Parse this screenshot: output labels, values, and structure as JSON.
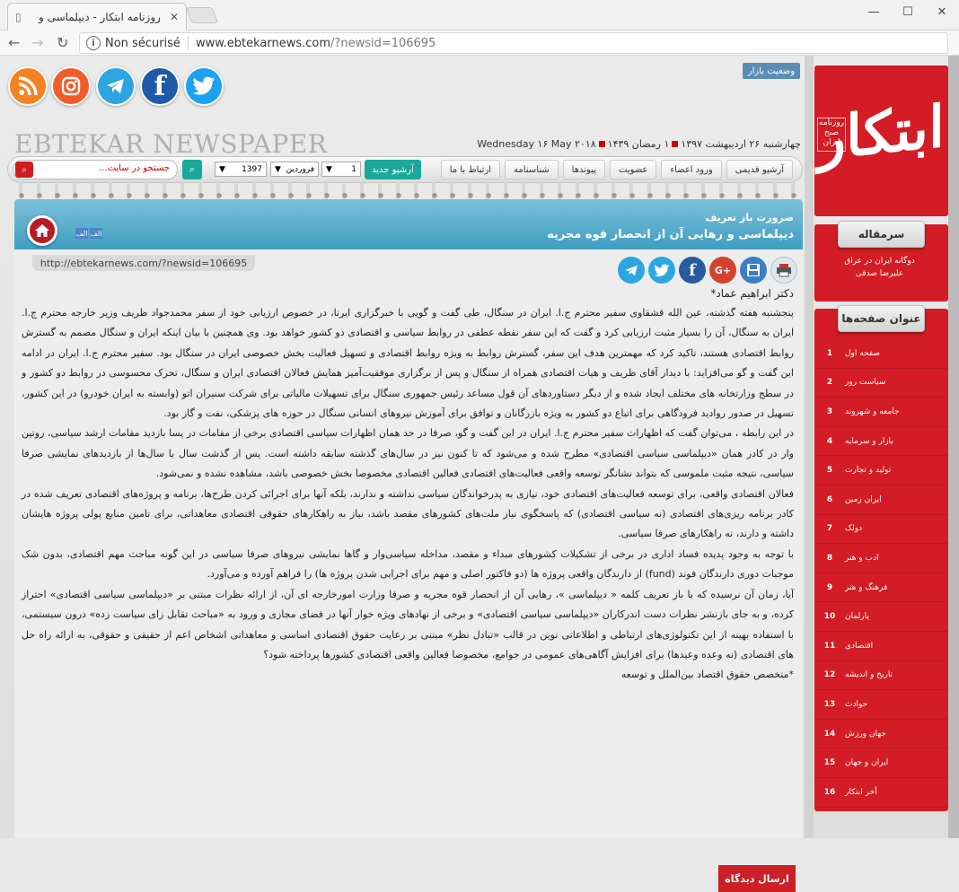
{
  "browser": {
    "tab_title": "روزنامه ابتکار - دیپلماسی و",
    "url_security": "Non sécurisé",
    "url_host": "www.ebtekarnews.com",
    "url_path": "/?newsid=106695"
  },
  "header": {
    "masthead_en": "EBTEKAR NEWSPAPER",
    "market_status": "وضعیت بازار",
    "date_persian": "چهارشنبه ۲۶ اردیبهشت ۱۳۹۷",
    "date_hijri": "۱ رمضان ۱۴۳۹",
    "date_gregorian": "Wednesday ۱۶ May ۲۰۱۸",
    "logo_text": "ابتکار",
    "logo_mark": "روزنامه صبح ایران"
  },
  "nav": {
    "items": [
      "آرشیو قدیمی",
      "ورود اعضاء",
      "عضویت",
      "پیوندها",
      "شناسنامه",
      "ارتباط با ما"
    ],
    "archive_button": "آرشیو جدید",
    "day": "1",
    "month": "فروردین",
    "year": "1397",
    "search_placeholder": "جستجو در سایت..."
  },
  "article": {
    "kicker": "ضرورت باز تعریف",
    "headline": "دیپلماسی و رهایی آن از انحصار قوه مجریه",
    "font_increase": "الف",
    "font_decrease": "الف",
    "short_url": "http://ebtekarnews.com/?newsid=106695",
    "author": "دکتر ابراهیم عماد*",
    "paragraphs": [
      "پنجشنبه هفته گذشته، عین الله قشقاوی سفیر محترم ج.ا. ایران در سنگال، طی گفت و گویی با خبرگزاری ایرنا، در خصوص ارزیابی خود از سفر محمدجواد ظریف وزیر خارجه محترم ج.ا. ایران به سنگال، آن را بسیار مثبت ارزیابی کرد و گفت که این سفر نقطه عطفی در روابط سیاسی و اقتصادی دو کشور خواهد بود. وی همچنین با بیان اینکه ایران و سنگال مصمم به گسترش روابط اقتصادی هستند، تاکید کرد که مهمترین هدف این سفر، گسترش روابط به ویژه روابط اقتصادی و تسهیل فعالیت بخش خصوصی ایران در سنگال بود. سفیر محترم ج.ا. ایران در ادامه این گفت و گو می‌افزاید: با دیدار آقای ظریف و هیات اقتصادی همراه از سنگال و پس از برگزاری موفقیت‌آمیز همایش فعالان اقتصادی ایران و سنگال، تحرک محسوسی در روابط دو کشور و در سطح وزارتخانه های مختلف ایجاد شده و از دیگر دستاوردهای آن قول مساعد رئیس جمهوری سنگال برای تسهیلات مالیاتی برای شرکت سنیران اتو (وابسته به ایران خودرو) در این کشور، تسهیل در صدور روادید فرودگاهی برای اتباع دو کشور به ویژه بازرگانان و توافق برای آموزش نیروهای انسانی سنگال در حوزه های پزشکی، نفت و گاز بود.",
      "در این رابطه ، می‌توان گفت که اظهارات سفیر محترم ج.ا. ایران در این گفت و گو، صرفا در حد همان اظهارات سیاسی اقتصادی برخی از مقامات در پسا بازدید مقامات ارشد سیاسی، روتین وار در کادر همان «دیپلماسی سیاسی اقتصادی» مطرح شده و می‌شود که تا کنون نیز در سال‌های گذشته سابقه داشته است. پس از گذشت سال با سال‌ها از بازدیدهای نمایشی صرفا سیاسی، نتیجه مثبت ملموسی که بتواند نشانگر توسعه واقعی فعالیت‌های اقتصادی فعالین اقتصادی مخصوصا بخش خصوصی باشد، مشاهده نشده و نمی‌شود.",
      "فعالان اقتصادی واقعی، برای توسعه فعالیت‌های اقتصادی خود، نیازی به پدرخواندگان سیاسی نداشته و ندارند، بلکه آنها برای اجرائی کردن طرح‌ها، برنامه و پروژه‌های اقتصادی تعریف شده در کادر برنامه ریزی‌های اقتصادی (نه سیاسی اقتصادی) که پاسخگوی نیاز ملت‌های کشورهای مقصد باشد، نیاز به راهکارهای حقوقی اقتصادی معاهداتی، برای تامین منابع پولی پروژه هایشان داشته و دارند، نه راهکارهای صرفا سیاسی.",
      "با توجه به وجود پدیده فساد اداری در برخی از تشکیلات کشورهای مبداء و مقصد، مداخله سیاسی‌وار و گاها نمایشی نیروهای صرفا سیاسی در این گونه مباحث مهم اقتصادی، بدون شک موجبات دوری دارندگان فوند (fund) از دارندگان واقعی پروژه ها (دو فاکتور اصلی و مهم برای اجرایی شدن پروژه ها) را فراهم آورده و می‌آورد.",
      "آیا، زمان آن نرسیده که با باز تعریف کلمه « دیپلماسی »، رهایی آن از انحصار قوه مجریه و صرفا وزارت امورخارجه ای آن، از ارائه نظرات مبتنی بر «دیپلماسی سیاسی اقتصادی» احتراز کرده، و به جای بازنشر نظرات دست اندرکاران «دیپلماسی سیاسی اقتصادی» و برخی از نهادهای ویژه خوار آنها در فضای مجازی و ورود به «مباحث تقابل زای سیاست زده» درون سیستمی، با استفاده بهینه از این تکنولوژی‌های ارتباطی و اطلاعاتی نوین در قالب «تبادل نظر» مبتنی بر رعایت حقوق اقتصادی اساسی و معاهداتی اشخاص اعم از حقیقی و حقوقی، به ارائه راه حل های اقتصادی (نه وعده وعیدها) برای افزایش آگاهی‌های عمومی در جوامع، مخصوصا فعالین واقعی اقتصادی کشورها پرداخته شود؟",
      "*متخصص حقوق اقتصاد بین‌الملل و توسعه"
    ],
    "comment_button": "ارسال دیدگاه"
  },
  "sidebar": {
    "editorial_label": "سرمقاله",
    "editorial_title": "دوگانه ایران در عراق",
    "editorial_author": "علیرضا صدقی",
    "pages_label": "عنوان صفحه‌ها",
    "pages": [
      {
        "num": "1",
        "title": "صفحه اول"
      },
      {
        "num": "2",
        "title": "سیاست روز"
      },
      {
        "num": "3",
        "title": "جامعه و شهروند"
      },
      {
        "num": "4",
        "title": "بازار و سرمایه"
      },
      {
        "num": "5",
        "title": "تولید و تجارت"
      },
      {
        "num": "6",
        "title": "ایران زمین"
      },
      {
        "num": "7",
        "title": "دولک"
      },
      {
        "num": "8",
        "title": "ادب و هنر"
      },
      {
        "num": "9",
        "title": "فرهنگ و هنر"
      },
      {
        "num": "10",
        "title": "پارلمان"
      },
      {
        "num": "11",
        "title": "اقتصادی"
      },
      {
        "num": "12",
        "title": "تاریخ و اندیشه"
      },
      {
        "num": "13",
        "title": "حوادث"
      },
      {
        "num": "14",
        "title": "جهان ورزش"
      },
      {
        "num": "15",
        "title": "ایران و جهان"
      },
      {
        "num": "16",
        "title": "آخر ابتکار"
      }
    ]
  },
  "colors": {
    "brand_red": "#d31c25",
    "accent_teal": "#1aa89a",
    "header_blue": "#3f9ec2"
  }
}
